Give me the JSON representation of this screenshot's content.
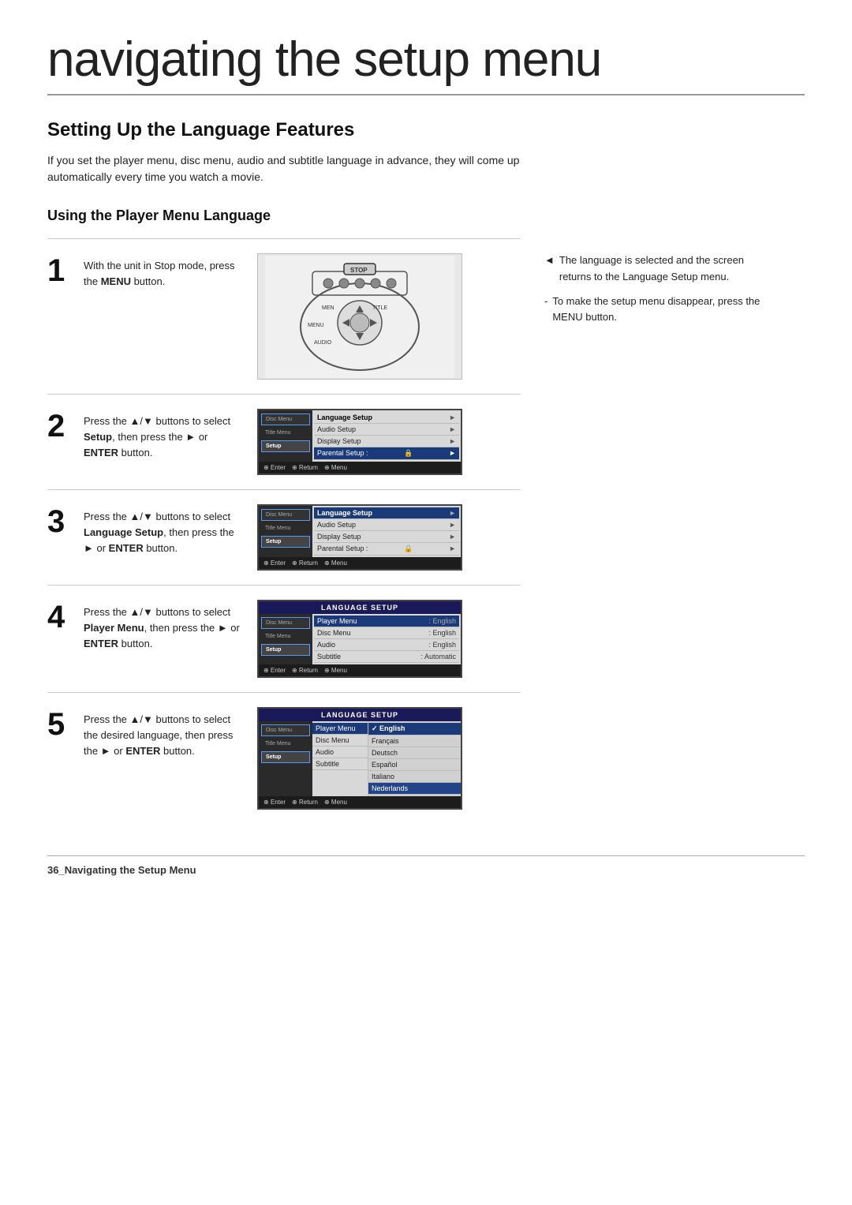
{
  "page": {
    "title": "navigating the setup menu",
    "section_title": "Setting Up the Language Features",
    "intro": "If you set the player menu, disc menu, audio and subtitle language in advance, they will come up automatically every time you watch a movie.",
    "subsection": "Using the Player Menu Language",
    "footer": "36_Navigating the Setup Menu"
  },
  "steps": [
    {
      "number": "1",
      "text": "With the unit in Stop mode, press the ",
      "text_bold": "MENU",
      "text_after": " button.",
      "type": "remote"
    },
    {
      "number": "2",
      "text": "Press the ▲/▼ buttons to select ",
      "text_bold": "Setup",
      "text_after": ", then press the ► or ",
      "text_bold2": "ENTER",
      "text_after2": " button.",
      "type": "setup_menu"
    },
    {
      "number": "3",
      "text": "Press the ▲/▼ buttons to select ",
      "text_bold": "Language Setup",
      "text_after": ", then press the ► or ",
      "text_bold2": "ENTER",
      "text_after2": " button.",
      "type": "language_menu"
    },
    {
      "number": "4",
      "text": "Press the ▲/▼ buttons to select ",
      "text_bold": "Player Menu",
      "text_after": ", then press the ► or ",
      "text_bold2": "ENTER",
      "text_after2": " button.",
      "type": "language_setup"
    },
    {
      "number": "5",
      "text": "Press the ▲/▼ buttons to select the desired language, then press the ► or ",
      "text_bold": "ENTER",
      "text_after": " button.",
      "type": "language_select"
    }
  ],
  "notes": [
    {
      "symbol": "◄",
      "text": "The language is selected and the screen returns to the Language Setup menu."
    },
    {
      "symbol": "-",
      "text": "To make the setup menu disappear, press the MENU button."
    }
  ],
  "menu_screens": {
    "setup_menu": {
      "items": [
        "Language Setup",
        "Audio Setup",
        "Display Setup",
        "Parental Setup :"
      ],
      "highlighted": "Parental Setup :",
      "sidebar_items": [
        "Disc Menu",
        "Title Menu",
        "Setup"
      ]
    },
    "language_menu": {
      "items": [
        "Language Setup",
        "Audio Setup",
        "Display Setup",
        "Parental Setup :"
      ],
      "highlighted": "Language Setup",
      "sidebar_items": [
        "Disc Menu",
        "Title Menu",
        "Setup"
      ]
    },
    "language_setup": {
      "header": "LANGUAGE SETUP",
      "rows": [
        {
          "label": "Player Menu",
          "value": "English"
        },
        {
          "label": "Disc Menu",
          "value": "English"
        },
        {
          "label": "Audio",
          "value": "English"
        },
        {
          "label": "Subtitle",
          "value": "Automatic"
        }
      ],
      "highlighted": "Player Menu",
      "sidebar_items": [
        "Disc Menu",
        "Title Menu",
        "Setup"
      ]
    },
    "language_select": {
      "header": "LANGUAGE SETUP",
      "rows": [
        {
          "label": "Player Menu",
          "value": ""
        },
        {
          "label": "Disc Menu",
          "value": ""
        },
        {
          "label": "Audio",
          "value": ""
        },
        {
          "label": "Subtitle",
          "value": ""
        }
      ],
      "languages": [
        "English",
        "Français",
        "Deutsch",
        "Español",
        "Italiano",
        "Nederlands"
      ],
      "highlighted_lang": "English",
      "sidebar_items": [
        "Disc Menu",
        "Title Menu",
        "Setup"
      ]
    }
  },
  "footer_label": "36_Navigating the Setup Menu"
}
